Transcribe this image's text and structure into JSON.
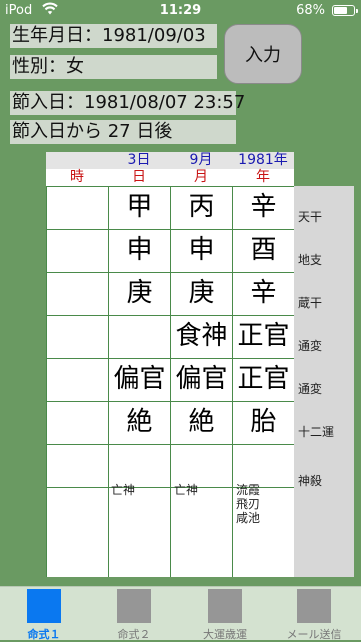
{
  "status": {
    "carrier": "iPod",
    "time": "11:29",
    "battery": "68%",
    "battery_level": 0.68
  },
  "form": {
    "birth": "生年月日：1981/09/03",
    "gender": "性別：女",
    "setsu": "節入日：1981/08/07 23:57",
    "setsu_days": "節入日から 27 日後",
    "enter_button": "入力"
  },
  "chart": {
    "top_headers": [
      "",
      "3日",
      "9月",
      "1981年"
    ],
    "pillars": [
      "時",
      "日",
      "月",
      "年"
    ],
    "rows": [
      {
        "label": "天干",
        "cells": [
          "",
          "甲",
          "丙",
          "辛"
        ]
      },
      {
        "label": "地支",
        "cells": [
          "",
          "申",
          "申",
          "酉"
        ]
      },
      {
        "label": "蔵干",
        "cells": [
          "",
          "庚",
          "庚",
          "辛"
        ]
      },
      {
        "label": "通変",
        "cells": [
          "",
          "",
          "食神",
          "正官"
        ]
      },
      {
        "label": "通変",
        "cells": [
          "",
          "偏官",
          "偏官",
          "正官"
        ]
      },
      {
        "label": "十二運",
        "cells": [
          "",
          "絶",
          "絶",
          "胎"
        ]
      }
    ],
    "shinsatsu_label": "神殺",
    "shinsatsu": [
      "",
      "亡神",
      "亡神",
      "流霞\n飛刃\n咸池"
    ]
  },
  "tabs": [
    {
      "label": "命式１",
      "active": true
    },
    {
      "label": "命式２",
      "active": false
    },
    {
      "label": "大運歳運",
      "active": false
    },
    {
      "label": "メール送信",
      "active": false
    }
  ]
}
